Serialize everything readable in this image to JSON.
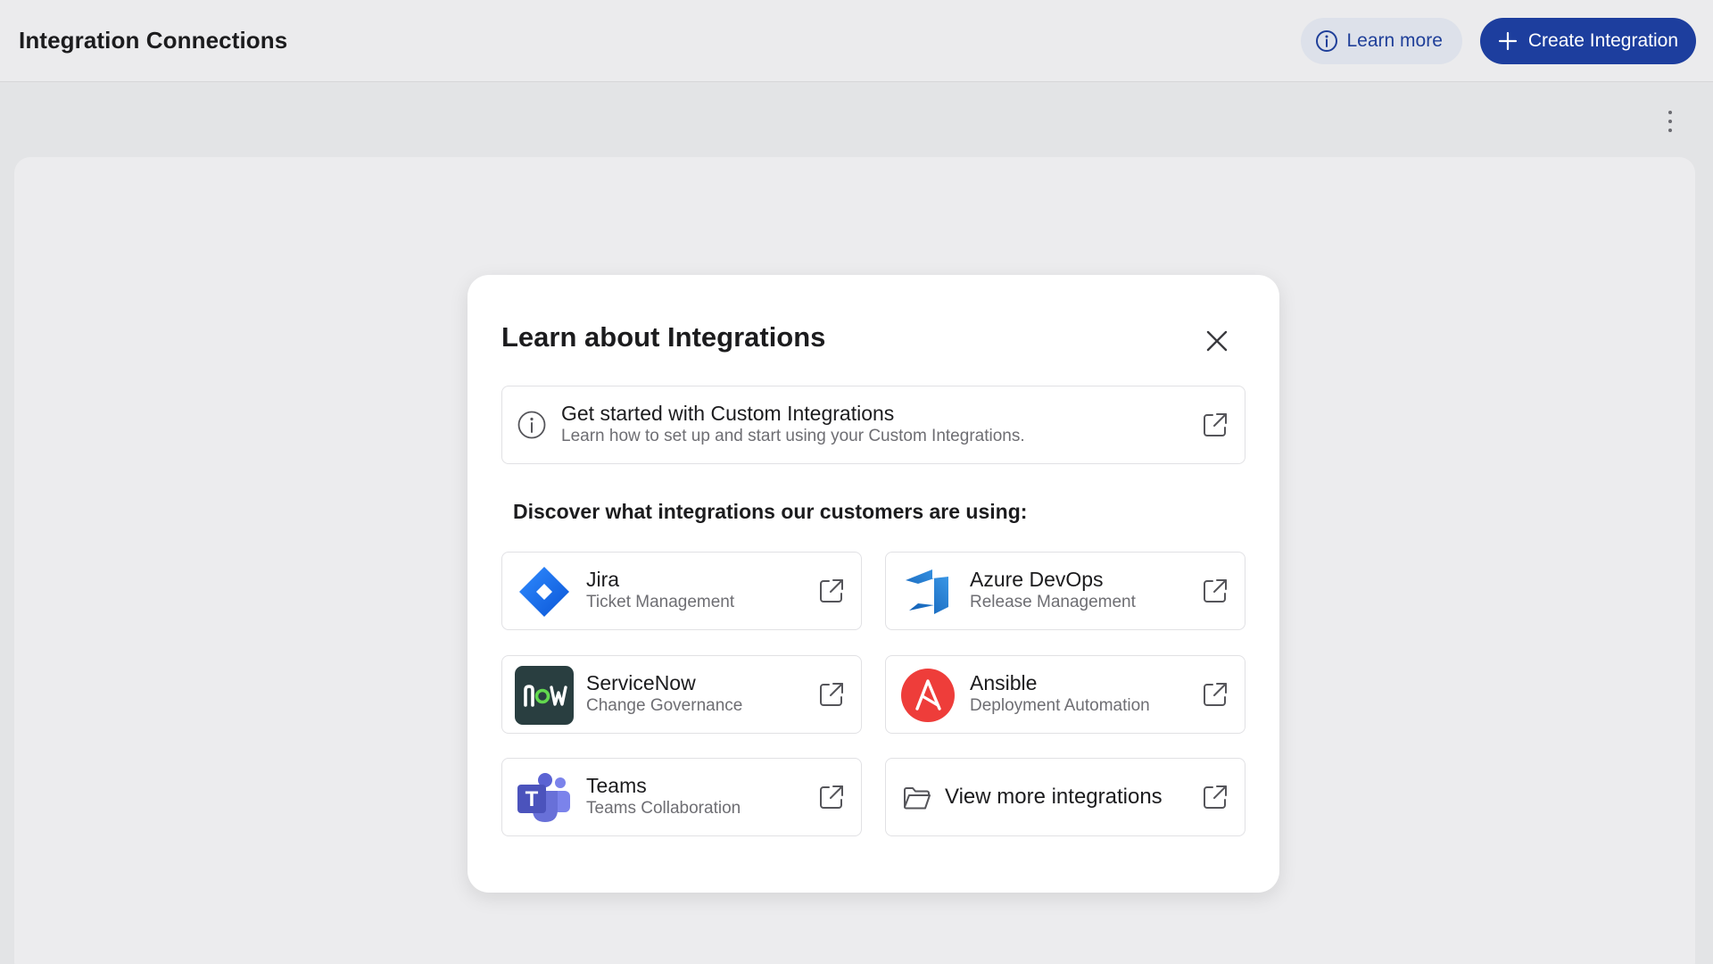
{
  "header": {
    "title": "Integration Connections",
    "learn_more_label": "Learn more",
    "create_label": "Create Integration"
  },
  "modal": {
    "title": "Learn about Integrations",
    "guide": {
      "title": "Get started with Custom Integrations",
      "subtitle": "Learn how to set up and start using your Custom Integrations."
    },
    "discover_heading": "Discover what integrations our customers are using:",
    "integrations": [
      {
        "name": "Jira",
        "category": "Ticket Management",
        "icon": "jira-logo-icon"
      },
      {
        "name": "Azure DevOps",
        "category": "Release Management",
        "icon": "azure-devops-logo-icon"
      },
      {
        "name": "ServiceNow",
        "category": "Change Governance",
        "icon": "servicenow-logo-icon"
      },
      {
        "name": "Ansible",
        "category": "Deployment Automation",
        "icon": "ansible-logo-icon"
      },
      {
        "name": "Teams",
        "category": "Teams Collaboration",
        "icon": "teams-logo-icon"
      }
    ],
    "view_more_label": "View more integrations"
  },
  "colors": {
    "primary": "#1d3e9e",
    "secondary_bg": "#dde1ea",
    "jira": "#2684ff",
    "azure": "#1f6fc4",
    "servicenow": "#293e40",
    "ansible": "#ee3d3a",
    "teams": "#5059c9"
  }
}
